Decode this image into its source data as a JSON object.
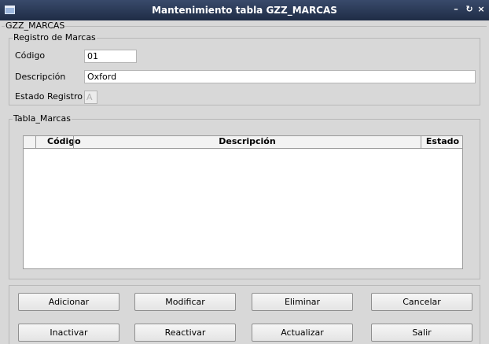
{
  "window": {
    "title": "Mantenimiento tabla GZZ_MARCAS",
    "controls": {
      "minimize": "–",
      "restore": "↻",
      "close": "×"
    }
  },
  "outer_group": {
    "legend": "GZZ_MARCAS"
  },
  "registro": {
    "legend": "Registro de Marcas",
    "codigo_label": "Código",
    "codigo_value": "01",
    "descripcion_label": "Descripción",
    "descripcion_value": "Oxford",
    "estado_label": "Estado Registro",
    "estado_value": "A"
  },
  "tabla": {
    "legend": "Tabla_Marcas",
    "columns": [
      "Código",
      "Descripción",
      "Estado"
    ],
    "rows": []
  },
  "buttons": {
    "adicionar": "Adicionar",
    "modificar": "Modificar",
    "eliminar": "Eliminar",
    "cancelar": "Cancelar",
    "inactivar": "Inactivar",
    "reactivar": "Reactivar",
    "actualizar": "Actualizar",
    "salir": "Salir"
  }
}
